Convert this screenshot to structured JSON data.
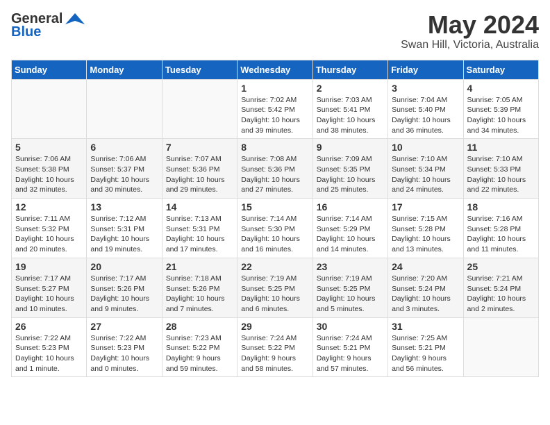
{
  "logo": {
    "line1": "General",
    "line2": "Blue"
  },
  "title": "May 2024",
  "location": "Swan Hill, Victoria, Australia",
  "days_header": [
    "Sunday",
    "Monday",
    "Tuesday",
    "Wednesday",
    "Thursday",
    "Friday",
    "Saturday"
  ],
  "weeks": [
    [
      {
        "num": "",
        "info": ""
      },
      {
        "num": "",
        "info": ""
      },
      {
        "num": "",
        "info": ""
      },
      {
        "num": "1",
        "info": "Sunrise: 7:02 AM\nSunset: 5:42 PM\nDaylight: 10 hours\nand 39 minutes."
      },
      {
        "num": "2",
        "info": "Sunrise: 7:03 AM\nSunset: 5:41 PM\nDaylight: 10 hours\nand 38 minutes."
      },
      {
        "num": "3",
        "info": "Sunrise: 7:04 AM\nSunset: 5:40 PM\nDaylight: 10 hours\nand 36 minutes."
      },
      {
        "num": "4",
        "info": "Sunrise: 7:05 AM\nSunset: 5:39 PM\nDaylight: 10 hours\nand 34 minutes."
      }
    ],
    [
      {
        "num": "5",
        "info": "Sunrise: 7:06 AM\nSunset: 5:38 PM\nDaylight: 10 hours\nand 32 minutes."
      },
      {
        "num": "6",
        "info": "Sunrise: 7:06 AM\nSunset: 5:37 PM\nDaylight: 10 hours\nand 30 minutes."
      },
      {
        "num": "7",
        "info": "Sunrise: 7:07 AM\nSunset: 5:36 PM\nDaylight: 10 hours\nand 29 minutes."
      },
      {
        "num": "8",
        "info": "Sunrise: 7:08 AM\nSunset: 5:36 PM\nDaylight: 10 hours\nand 27 minutes."
      },
      {
        "num": "9",
        "info": "Sunrise: 7:09 AM\nSunset: 5:35 PM\nDaylight: 10 hours\nand 25 minutes."
      },
      {
        "num": "10",
        "info": "Sunrise: 7:10 AM\nSunset: 5:34 PM\nDaylight: 10 hours\nand 24 minutes."
      },
      {
        "num": "11",
        "info": "Sunrise: 7:10 AM\nSunset: 5:33 PM\nDaylight: 10 hours\nand 22 minutes."
      }
    ],
    [
      {
        "num": "12",
        "info": "Sunrise: 7:11 AM\nSunset: 5:32 PM\nDaylight: 10 hours\nand 20 minutes."
      },
      {
        "num": "13",
        "info": "Sunrise: 7:12 AM\nSunset: 5:31 PM\nDaylight: 10 hours\nand 19 minutes."
      },
      {
        "num": "14",
        "info": "Sunrise: 7:13 AM\nSunset: 5:31 PM\nDaylight: 10 hours\nand 17 minutes."
      },
      {
        "num": "15",
        "info": "Sunrise: 7:14 AM\nSunset: 5:30 PM\nDaylight: 10 hours\nand 16 minutes."
      },
      {
        "num": "16",
        "info": "Sunrise: 7:14 AM\nSunset: 5:29 PM\nDaylight: 10 hours\nand 14 minutes."
      },
      {
        "num": "17",
        "info": "Sunrise: 7:15 AM\nSunset: 5:28 PM\nDaylight: 10 hours\nand 13 minutes."
      },
      {
        "num": "18",
        "info": "Sunrise: 7:16 AM\nSunset: 5:28 PM\nDaylight: 10 hours\nand 11 minutes."
      }
    ],
    [
      {
        "num": "19",
        "info": "Sunrise: 7:17 AM\nSunset: 5:27 PM\nDaylight: 10 hours\nand 10 minutes."
      },
      {
        "num": "20",
        "info": "Sunrise: 7:17 AM\nSunset: 5:26 PM\nDaylight: 10 hours\nand 9 minutes."
      },
      {
        "num": "21",
        "info": "Sunrise: 7:18 AM\nSunset: 5:26 PM\nDaylight: 10 hours\nand 7 minutes."
      },
      {
        "num": "22",
        "info": "Sunrise: 7:19 AM\nSunset: 5:25 PM\nDaylight: 10 hours\nand 6 minutes."
      },
      {
        "num": "23",
        "info": "Sunrise: 7:19 AM\nSunset: 5:25 PM\nDaylight: 10 hours\nand 5 minutes."
      },
      {
        "num": "24",
        "info": "Sunrise: 7:20 AM\nSunset: 5:24 PM\nDaylight: 10 hours\nand 3 minutes."
      },
      {
        "num": "25",
        "info": "Sunrise: 7:21 AM\nSunset: 5:24 PM\nDaylight: 10 hours\nand 2 minutes."
      }
    ],
    [
      {
        "num": "26",
        "info": "Sunrise: 7:22 AM\nSunset: 5:23 PM\nDaylight: 10 hours\nand 1 minute."
      },
      {
        "num": "27",
        "info": "Sunrise: 7:22 AM\nSunset: 5:23 PM\nDaylight: 10 hours\nand 0 minutes."
      },
      {
        "num": "28",
        "info": "Sunrise: 7:23 AM\nSunset: 5:22 PM\nDaylight: 9 hours\nand 59 minutes."
      },
      {
        "num": "29",
        "info": "Sunrise: 7:24 AM\nSunset: 5:22 PM\nDaylight: 9 hours\nand 58 minutes."
      },
      {
        "num": "30",
        "info": "Sunrise: 7:24 AM\nSunset: 5:21 PM\nDaylight: 9 hours\nand 57 minutes."
      },
      {
        "num": "31",
        "info": "Sunrise: 7:25 AM\nSunset: 5:21 PM\nDaylight: 9 hours\nand 56 minutes."
      },
      {
        "num": "",
        "info": ""
      }
    ]
  ]
}
